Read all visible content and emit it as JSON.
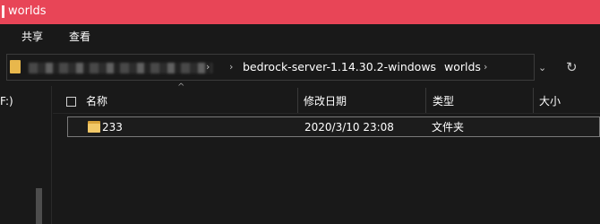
{
  "window": {
    "title": "worlds"
  },
  "ribbon": {
    "tabs": [
      "共享",
      "查看"
    ]
  },
  "address": {
    "breadcrumbs": [
      "bedrock-server-1.14.30.2-windows",
      "worlds"
    ],
    "separator": "›",
    "dropdown_glyph": "⌄",
    "refresh_glyph": "↻"
  },
  "nav": {
    "partial_text": "F:)"
  },
  "list": {
    "sort_glyph": "^",
    "columns": [
      "名称",
      "修改日期",
      "类型",
      "大小"
    ],
    "rows": [
      {
        "name": "233",
        "modified": "2020/3/10 23:08",
        "type": "文件夹",
        "size": "",
        "icon": "folder-icon"
      }
    ]
  },
  "colors": {
    "titlebar": "#e84557",
    "background": "#191919",
    "folder": "#f2c968"
  }
}
